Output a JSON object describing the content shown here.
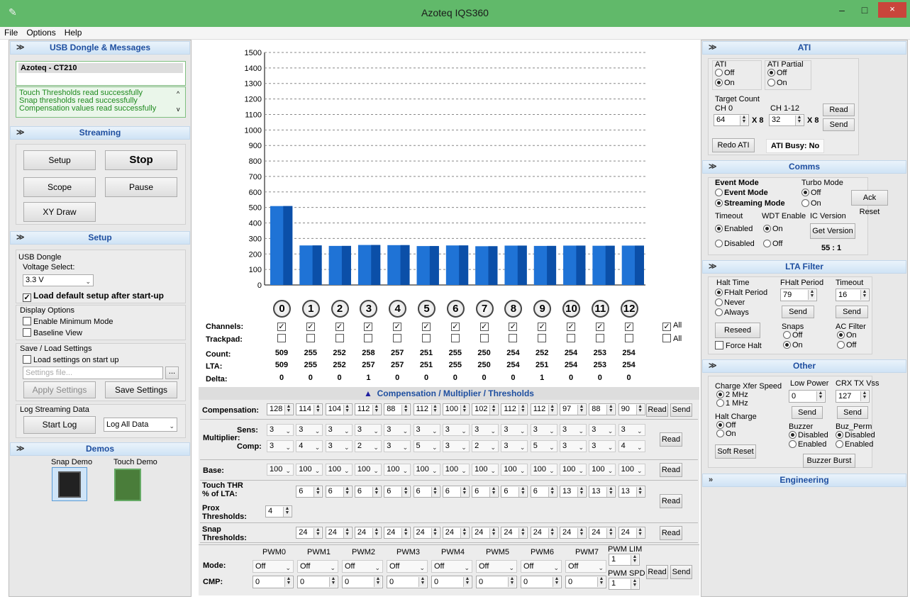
{
  "window": {
    "title": "Azoteq IQS360",
    "min": "–",
    "max": "□",
    "close": "×"
  },
  "menu": [
    "File",
    "Options",
    "Help"
  ],
  "usb": {
    "header": "USB Dongle & Messages",
    "device": "Azoteq - CT210",
    "messages": [
      "Touch Thresholds read successfully",
      "Snap thresholds read successfully",
      "Compensation values read successfully"
    ]
  },
  "streaming": {
    "header": "Streaming",
    "setup": "Setup",
    "stop": "Stop",
    "scope": "Scope",
    "pause": "Pause",
    "xy": "XY Draw"
  },
  "setup": {
    "header": "Setup",
    "usb_dongle": "USB Dongle",
    "voltage_label": "Voltage Select:",
    "voltage": "3.3 V",
    "load_default": "Load default setup after start-up",
    "display_options": "Display Options",
    "enable_min": "Enable Minimum Mode",
    "baseline": "Baseline View",
    "save_load": "Save / Load Settings",
    "load_on_start": "Load settings on start up",
    "settings_placeholder": "Settings file...",
    "browse": "...",
    "apply": "Apply Settings",
    "save": "Save Settings",
    "log_header": "Log Streaming Data",
    "start_log": "Start Log",
    "log_all": "Log All Data"
  },
  "demos": {
    "header": "Demos",
    "snap": "Snap Demo",
    "touch": "Touch Demo"
  },
  "chart_data": {
    "type": "bar",
    "categories": [
      "0",
      "1",
      "2",
      "3",
      "4",
      "5",
      "6",
      "7",
      "8",
      "9",
      "10",
      "11",
      "12"
    ],
    "values": [
      509,
      255,
      252,
      258,
      257,
      251,
      255,
      250,
      254,
      252,
      254,
      253,
      254
    ],
    "ylim": [
      0,
      1500
    ],
    "yticks": [
      "0",
      "100",
      "200",
      "300",
      "400",
      "500",
      "600",
      "700",
      "800",
      "900",
      "1000",
      "1100",
      "1200",
      "1300",
      "1400",
      "1500"
    ],
    "grid": true
  },
  "channels": {
    "labels": [
      "Channels:",
      "Trackpad:",
      "Count:",
      "LTA:",
      "Delta:"
    ],
    "all": "All",
    "count": [
      "509",
      "255",
      "252",
      "258",
      "257",
      "251",
      "255",
      "250",
      "254",
      "252",
      "254",
      "253",
      "254"
    ],
    "lta": [
      "509",
      "255",
      "252",
      "257",
      "257",
      "251",
      "255",
      "250",
      "254",
      "251",
      "254",
      "253",
      "254"
    ],
    "delta": [
      "0",
      "0",
      "0",
      "1",
      "0",
      "0",
      "0",
      "0",
      "0",
      "1",
      "0",
      "0",
      "0"
    ]
  },
  "comp": {
    "header": "Compensation / Multiplier / Thresholds",
    "compensation_label": "Compensation:",
    "compensation": [
      "128",
      "114",
      "104",
      "112",
      "88",
      "112",
      "100",
      "102",
      "112",
      "112",
      "97",
      "88",
      "90"
    ],
    "multiplier": "Multiplier:",
    "sens_label": "Sens:",
    "comp_label": "Comp:",
    "sens": [
      "3",
      "3",
      "3",
      "3",
      "3",
      "3",
      "3",
      "3",
      "3",
      "3",
      "3",
      "3",
      "3"
    ],
    "comp": [
      "3",
      "4",
      "3",
      "2",
      "3",
      "5",
      "3",
      "2",
      "3",
      "5",
      "3",
      "3",
      "4"
    ],
    "base_label": "Base:",
    "base": [
      "100",
      "100",
      "100",
      "100",
      "100",
      "100",
      "100",
      "100",
      "100",
      "100",
      "100",
      "100",
      "100"
    ],
    "touch_label1": "Touch THR",
    "touch_label2": "% of LTA:",
    "touch": [
      "6",
      "6",
      "6",
      "6",
      "6",
      "6",
      "6",
      "6",
      "6",
      "13",
      "13",
      "13"
    ],
    "prox_label1": "Prox",
    "prox_label2": "Thresholds:",
    "prox": "4",
    "snap_label1": "Snap",
    "snap_label2": "Thresholds:",
    "snap": [
      "24",
      "24",
      "24",
      "24",
      "24",
      "24",
      "24",
      "24",
      "24",
      "24",
      "24",
      "24"
    ],
    "read": "Read",
    "send": "Send"
  },
  "pwm": {
    "headers": [
      "PWM0",
      "PWM1",
      "PWM2",
      "PWM3",
      "PWM4",
      "PWM5",
      "PWM6",
      "PWM7"
    ],
    "mode_label": "Mode:",
    "cmp_label": "CMP:",
    "mode": "Off",
    "cmp": "0",
    "lim_label": "PWM LIM",
    "lim": "1",
    "spd_label": "PWM SPD",
    "spd": "1"
  },
  "ati": {
    "header": "ATI",
    "ati": "ATI",
    "off": "Off",
    "on": "On",
    "partial": "ATI Partial",
    "target": "Target Count",
    "ch0": "CH 0",
    "ch112": "CH 1-12",
    "ch0_val": "64",
    "ch112_val": "32",
    "x8": "X 8",
    "read": "Read",
    "send": "Send",
    "redo": "Redo ATI",
    "busy": "ATI Busy:  No"
  },
  "comms": {
    "header": "Comms",
    "event_mode": "Event Mode",
    "event": "Event Mode",
    "streaming": "Streaming Mode",
    "turbo": "Turbo Mode",
    "ack": "Ack Reset",
    "timeout": "Timeout",
    "enabled": "Enabled",
    "disabled": "Disabled",
    "wdt": "WDT Enable",
    "ic": "IC Version",
    "get": "Get Version",
    "version": "55 : 1"
  },
  "lta": {
    "header": "LTA Filter",
    "halt": "Halt Time",
    "fhalt_period": "FHalt Period",
    "never": "Never",
    "always": "Always",
    "fhalt_label": "FHalt Period",
    "fhalt_val": "79",
    "timeout": "Timeout",
    "timeout_val": "16",
    "send": "Send",
    "reseed": "Reseed",
    "snaps": "Snaps",
    "ac": "AC Filter",
    "force": "Force Halt"
  },
  "other": {
    "header": "Other",
    "charge": "Charge Xfer Speed",
    "mhz2": "2 MHz",
    "mhz1": "1 MHz",
    "lowpower": "Low Power",
    "lp_val": "0",
    "crx": "CRX TX Vss",
    "crx_val": "127",
    "send": "Send",
    "halt_charge": "Halt Charge",
    "buzzer": "Buzzer",
    "buz_perm": "Buz_Perm",
    "disabled": "Disabled",
    "enabled": "Enabled",
    "soft": "Soft Reset",
    "burst": "Buzzer Burst"
  },
  "engineering": {
    "header": "Engineering"
  }
}
